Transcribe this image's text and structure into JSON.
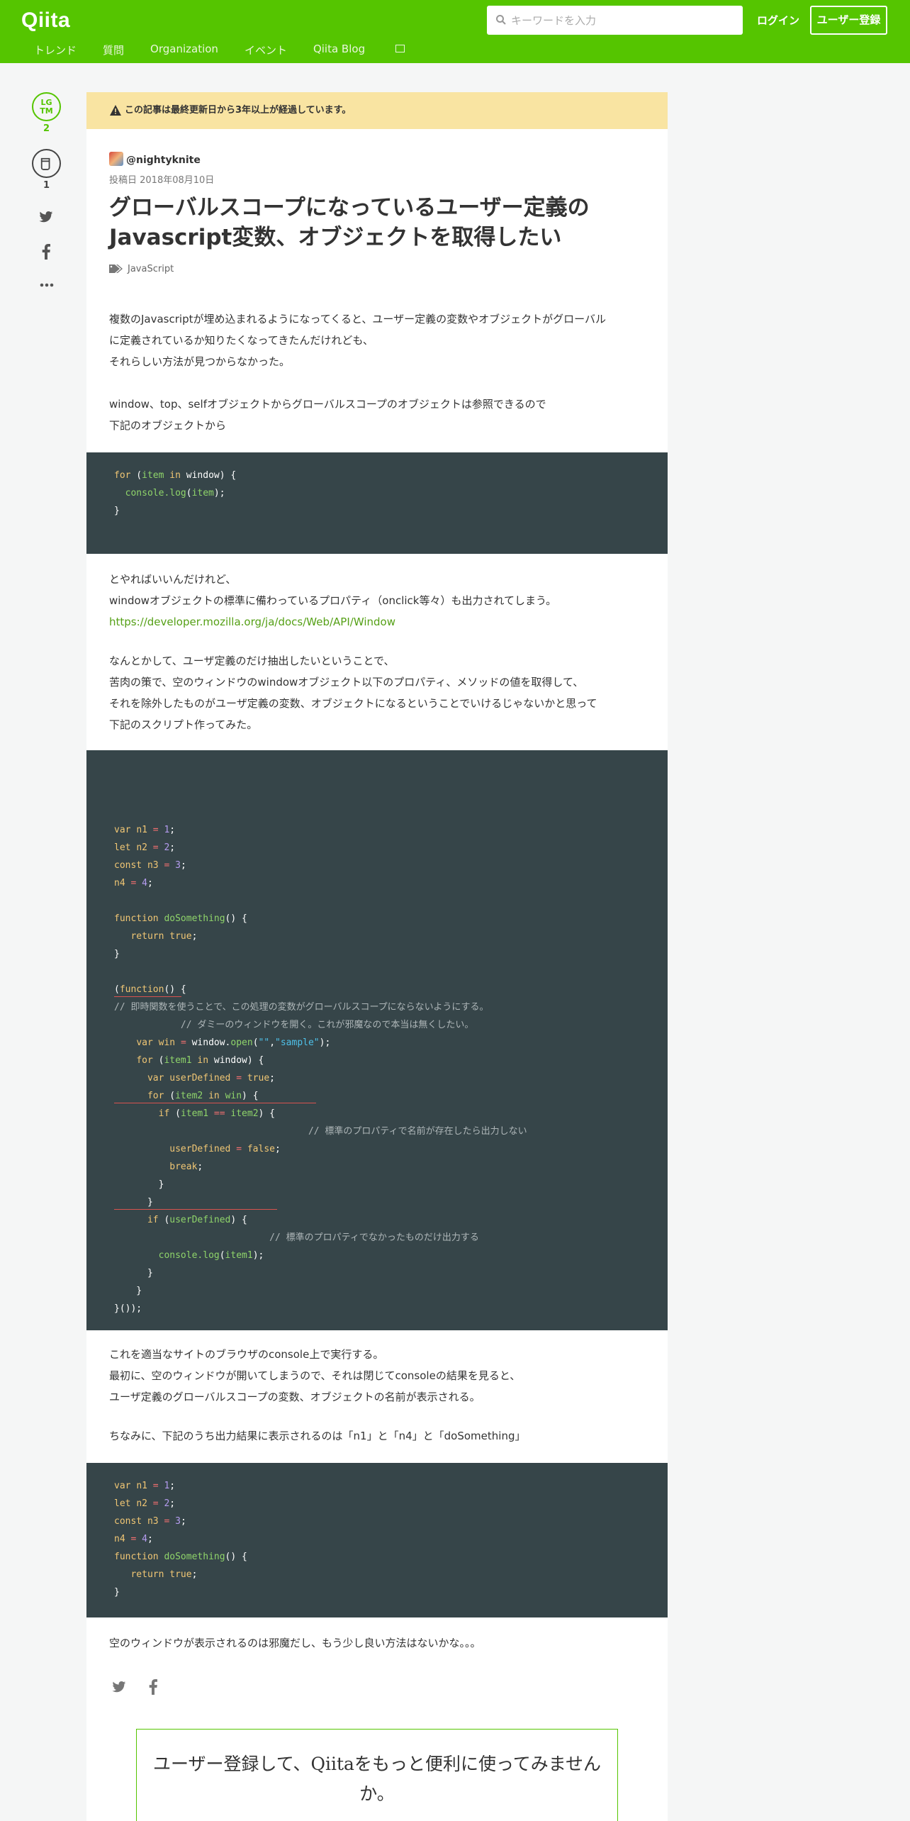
{
  "header": {
    "logo": "Qiita",
    "search_placeholder": "キーワードを入力",
    "login": "ログイン",
    "signup": "ユーザー登録",
    "nav": [
      "トレンド",
      "質問",
      "Organization",
      "イベント",
      "Qiita Blog"
    ]
  },
  "side": {
    "lgtm_label_top": "LG",
    "lgtm_label_bottom": "TM",
    "lgtm_count": "2",
    "stock_count": "1"
  },
  "article": {
    "warning": "この記事は最終更新日から3年以上が経過しています。",
    "author": "@nightyknite",
    "posted": "投稿日 2018年08月10日",
    "title": "グローバルスコープになっているユーザー定義のJavascript変数、オブジェクトを取得したい",
    "tag": "JavaScript",
    "p1": [
      "複数のJavascriptが埋め込まれるようになってくると、ユーザー定義の変数やオブジェクトがグローバル",
      "に定義されているか知りたくなってきたんだけれども、",
      "それらしい方法が見つからなかった。"
    ],
    "p2": [
      "window、top、selfオブジェクトからグローバルスコープのオブジェクトは参照できるので",
      "下記のオブジェクトから"
    ],
    "p3": [
      "とやればいいんだけれど、",
      "windowオブジェクトの標準に備わっているプロパティ（onclick等々）も出力されてしまう。"
    ],
    "link": "https://developer.mozilla.org/ja/docs/Web/API/Window",
    "p4": [
      "なんとかして、ユーザ定義のだけ抽出したいということで、",
      "苦肉の策で、空のウィンドウのwindowオブジェクト以下のプロパティ、メソッドの値を取得して、",
      "それを除外したものがユーザ定義の変数、オブジェクトになるということでいけるじゃないかと思って",
      "下記のスクリプト作ってみた。"
    ],
    "p5": [
      "これを適当なサイトのブラウザのconsole上で実行する。",
      "最初に、空のウィンドウが開いてしまうので、それは閉じてconsoleの結果を見ると、",
      "ユーザ定義のグローバルスコープの変数、オブジェクトの名前が表示される。"
    ],
    "p6": "ちなみに、下記のうち出力結果に表示されるのは「n1」と「n4」と「doSomething」",
    "p7": "空のウィンドウが表示されるのは邪魔だし、もう少し良い方法はないかな。。。",
    "cta": [
      "ユーザー登録して、Qiitaをもっと便利に使ってみません",
      "か。"
    ]
  },
  "code1": [
    [
      [
        "kw",
        "for"
      ],
      [
        "t",
        " ("
      ],
      [
        "fn",
        "item"
      ],
      [
        "t",
        " "
      ],
      [
        "kw",
        "in"
      ],
      [
        "t",
        " window) {"
      ]
    ],
    [
      [
        "t",
        "  "
      ],
      [
        "fn",
        "console.log"
      ],
      [
        "t",
        "("
      ],
      [
        "fn",
        "item"
      ],
      [
        "t",
        ");"
      ]
    ],
    [
      [
        "t",
        "}"
      ]
    ]
  ],
  "code2": [
    [
      [
        "kw",
        "var"
      ],
      [
        "t",
        " "
      ],
      [
        "var",
        "n1"
      ],
      [
        "t",
        " "
      ],
      [
        "op",
        "="
      ],
      [
        "t",
        " "
      ],
      [
        "num",
        "1"
      ],
      [
        "t",
        ";"
      ]
    ],
    [
      [
        "kw",
        "let"
      ],
      [
        "t",
        " "
      ],
      [
        "var",
        "n2"
      ],
      [
        "t",
        " "
      ],
      [
        "op",
        "="
      ],
      [
        "t",
        " "
      ],
      [
        "num",
        "2"
      ],
      [
        "t",
        ";"
      ]
    ],
    [
      [
        "kw",
        "const"
      ],
      [
        "t",
        " "
      ],
      [
        "var",
        "n3"
      ],
      [
        "t",
        " "
      ],
      [
        "op",
        "="
      ],
      [
        "t",
        " "
      ],
      [
        "num",
        "3"
      ],
      [
        "t",
        ";"
      ]
    ],
    [
      [
        "var",
        "n4"
      ],
      [
        "t",
        " "
      ],
      [
        "op",
        "="
      ],
      [
        "t",
        " "
      ],
      [
        "num",
        "4"
      ],
      [
        "t",
        ";"
      ]
    ],
    [
      [
        "t",
        ""
      ]
    ],
    [
      [
        "kw",
        "function"
      ],
      [
        "t",
        " "
      ],
      [
        "fn",
        "doSomething"
      ],
      [
        "t",
        "() {"
      ]
    ],
    [
      [
        "t",
        "   "
      ],
      [
        "kw",
        "return"
      ],
      [
        "t",
        " "
      ],
      [
        "kw",
        "true"
      ],
      [
        "t",
        ";"
      ]
    ],
    [
      [
        "t",
        "}"
      ]
    ],
    [
      [
        "t",
        ""
      ]
    ],
    [
      [
        "t",
        "("
      ],
      [
        "kw",
        "function"
      ],
      [
        "t",
        "() {"
      ]
    ],
    [
      [
        "cm",
        "// 即時関数を使うことで、この処理の変数がグローバルスコープにならないようにする。"
      ]
    ],
    [
      [
        "t",
        "            "
      ],
      [
        "cm",
        "// ダミーのウィンドウを開く。これが邪魔なので本当は無くしたい。"
      ]
    ],
    [
      [
        "t",
        "    "
      ],
      [
        "kw",
        "var"
      ],
      [
        "t",
        " "
      ],
      [
        "var",
        "win"
      ],
      [
        "t",
        " "
      ],
      [
        "op",
        "="
      ],
      [
        "t",
        " window."
      ],
      [
        "fn",
        "open"
      ],
      [
        "t",
        "("
      ],
      [
        "str",
        "\"\""
      ],
      [
        "t",
        ","
      ],
      [
        "str",
        "\"sample\""
      ],
      [
        "t",
        ");"
      ]
    ],
    [
      [
        "t",
        "    "
      ],
      [
        "kw",
        "for"
      ],
      [
        "t",
        " ("
      ],
      [
        "fn",
        "item1"
      ],
      [
        "t",
        " "
      ],
      [
        "kw",
        "in"
      ],
      [
        "t",
        " window) {"
      ]
    ],
    [
      [
        "t",
        "      "
      ],
      [
        "kw",
        "var"
      ],
      [
        "t",
        " "
      ],
      [
        "var",
        "userDefined"
      ],
      [
        "t",
        " "
      ],
      [
        "op",
        "="
      ],
      [
        "t",
        " "
      ],
      [
        "kw",
        "true"
      ],
      [
        "t",
        ";"
      ]
    ],
    [
      [
        "t",
        "      "
      ],
      [
        "kw",
        "for"
      ],
      [
        "t",
        " ("
      ],
      [
        "fn",
        "item2"
      ],
      [
        "t",
        " "
      ],
      [
        "kw",
        "in"
      ],
      [
        "t",
        " "
      ],
      [
        "fn",
        "win"
      ],
      [
        "t",
        ") {"
      ]
    ],
    [
      [
        "t",
        "        "
      ],
      [
        "kw",
        "if"
      ],
      [
        "t",
        " ("
      ],
      [
        "fn",
        "item1"
      ],
      [
        "t",
        " "
      ],
      [
        "op",
        "=="
      ],
      [
        "t",
        " "
      ],
      [
        "fn",
        "item2"
      ],
      [
        "t",
        ") {"
      ]
    ],
    [
      [
        "t",
        "                                   "
      ],
      [
        "cm",
        "// 標準のプロパティで名前が存在したら出力しない"
      ]
    ],
    [
      [
        "t",
        "          "
      ],
      [
        "var",
        "userDefined"
      ],
      [
        "t",
        " "
      ],
      [
        "op",
        "="
      ],
      [
        "t",
        " "
      ],
      [
        "kw",
        "false"
      ],
      [
        "t",
        ";"
      ]
    ],
    [
      [
        "t",
        "          "
      ],
      [
        "kw",
        "break"
      ],
      [
        "t",
        ";"
      ]
    ],
    [
      [
        "t",
        "        }"
      ]
    ],
    [
      [
        "t",
        "      }"
      ]
    ],
    [
      [
        "t",
        "      "
      ],
      [
        "kw",
        "if"
      ],
      [
        "t",
        " ("
      ],
      [
        "fn",
        "userDefined"
      ],
      [
        "t",
        ") {"
      ]
    ],
    [
      [
        "t",
        "                            "
      ],
      [
        "cm",
        "// 標準のプロパティでなかったものだけ出力する"
      ]
    ],
    [
      [
        "t",
        "        "
      ],
      [
        "fn",
        "console.log"
      ],
      [
        "t",
        "("
      ],
      [
        "fn",
        "item1"
      ],
      [
        "t",
        ");"
      ]
    ],
    [
      [
        "t",
        "      }"
      ]
    ],
    [
      [
        "t",
        "    }"
      ]
    ],
    [
      [
        "t",
        "}());"
      ]
    ]
  ],
  "code3": [
    [
      [
        "kw",
        "var"
      ],
      [
        "t",
        " "
      ],
      [
        "var",
        "n1"
      ],
      [
        "t",
        " "
      ],
      [
        "op",
        "="
      ],
      [
        "t",
        " "
      ],
      [
        "num",
        "1"
      ],
      [
        "t",
        ";"
      ]
    ],
    [
      [
        "kw",
        "let"
      ],
      [
        "t",
        " "
      ],
      [
        "var",
        "n2"
      ],
      [
        "t",
        " "
      ],
      [
        "op",
        "="
      ],
      [
        "t",
        " "
      ],
      [
        "num",
        "2"
      ],
      [
        "t",
        ";"
      ]
    ],
    [
      [
        "kw",
        "const"
      ],
      [
        "t",
        " "
      ],
      [
        "var",
        "n3"
      ],
      [
        "t",
        " "
      ],
      [
        "op",
        "="
      ],
      [
        "t",
        " "
      ],
      [
        "num",
        "3"
      ],
      [
        "t",
        ";"
      ]
    ],
    [
      [
        "var",
        "n4"
      ],
      [
        "t",
        " "
      ],
      [
        "op",
        "="
      ],
      [
        "t",
        " "
      ],
      [
        "num",
        "4"
      ],
      [
        "t",
        ";"
      ]
    ],
    [
      [
        "kw",
        "function"
      ],
      [
        "t",
        " "
      ],
      [
        "fn",
        "doSomething"
      ],
      [
        "t",
        "() {"
      ]
    ],
    [
      [
        "t",
        "   "
      ],
      [
        "kw",
        "return"
      ],
      [
        "t",
        " "
      ],
      [
        "kw",
        "true"
      ],
      [
        "t",
        ";"
      ]
    ],
    [
      [
        "t",
        "}"
      ]
    ]
  ],
  "colors": {
    "brand": "#55c500",
    "code_bg": "#364549",
    "warning_bg": "#f9e4a2",
    "link": "#55a016"
  },
  "icons": [
    "search-icon",
    "external-link-icon",
    "stock-icon",
    "twitter-icon",
    "facebook-icon",
    "more-icon",
    "warning-icon",
    "tag-icon"
  ]
}
